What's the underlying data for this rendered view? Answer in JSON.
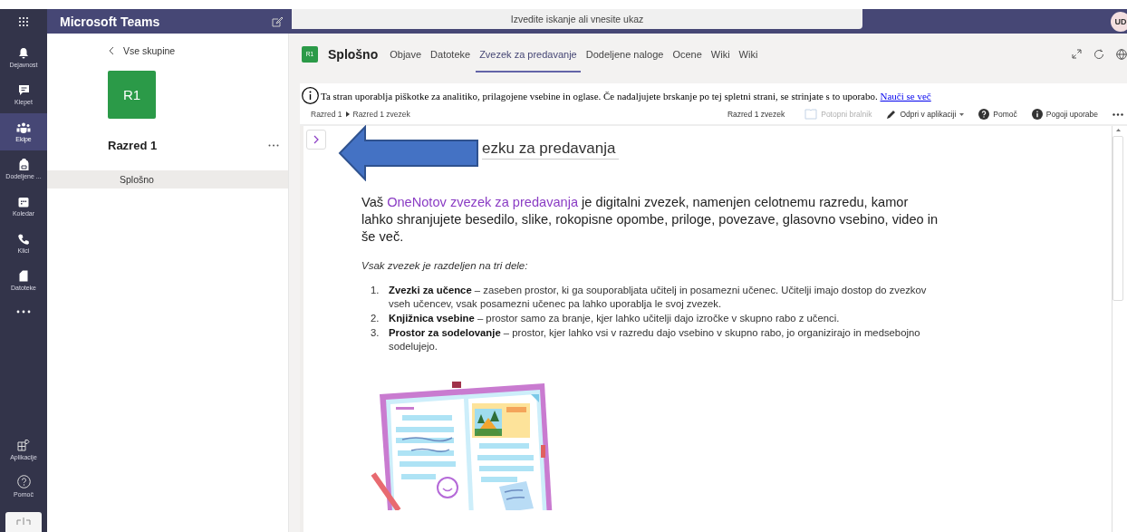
{
  "app_bar": {
    "title": "Microsoft Teams",
    "search": {
      "placeholder": "Izvedite iskanje ali vnesite ukaz"
    },
    "avatar": "UD"
  },
  "rail": [
    {
      "label": "Dejavnost",
      "kind": "bell",
      "selected": false
    },
    {
      "label": "Klepet",
      "kind": "chat",
      "selected": false
    },
    {
      "label": "Ekipe",
      "kind": "teams",
      "selected": true
    },
    {
      "label": "Dodeljene ...",
      "kind": "backpack",
      "selected": false
    },
    {
      "label": "Koledar",
      "kind": "calendar",
      "selected": false
    },
    {
      "label": "Klici",
      "kind": "phone",
      "selected": false
    },
    {
      "label": "Datoteke",
      "kind": "file",
      "selected": false
    }
  ],
  "rail_bottom": [
    {
      "label": "Aplikacije",
      "kind": "apps",
      "selected": false
    },
    {
      "label": "Pomoč",
      "kind": "help",
      "selected": false
    }
  ],
  "team_panel": {
    "back": "Vse skupine",
    "tile": "R1",
    "name": "Razred 1",
    "channels": [
      {
        "name": "Splošno",
        "selected": true
      }
    ]
  },
  "channel_header": {
    "tile": "R1",
    "name": "Splošno",
    "tabs": [
      {
        "label": "Objave",
        "selected": false
      },
      {
        "label": "Datoteke",
        "selected": false
      },
      {
        "label": "Zvezek za predavanje",
        "selected": true
      },
      {
        "label": "Dodeljene naloge",
        "selected": false
      },
      {
        "label": "Ocene",
        "selected": false
      },
      {
        "label": "Wiki",
        "selected": false
      },
      {
        "label": "Wiki",
        "selected": false
      }
    ]
  },
  "cookie_banner": {
    "text": "Ta stran uporablja piškotke za analitiko, prilagojene vsebine in oglase. Če nadaljujete brskanje po tej spletni strani, se strinjate s to uporabo.",
    "link": "Nauči se več"
  },
  "toolbar": {
    "breadcrumb": [
      "Razred 1",
      "Razred 1 zvezek"
    ],
    "notebook": "Razred 1 zvezek",
    "actions": [
      {
        "label": "Potopni bralnik",
        "kind": "reader",
        "disabled": true
      },
      {
        "label": "Odpri v aplikaciji",
        "kind": "edit",
        "disabled": false
      },
      {
        "label": "Pomoč",
        "kind": "help",
        "disabled": false
      },
      {
        "label": "Pogoji uporabe",
        "kind": "info",
        "disabled": false
      }
    ]
  },
  "page": {
    "title": "ezku za predavanja",
    "intro_before": "Vaš",
    "intro_link": "OneNotov zvezek za predavanja",
    "intro_after": "je digitalni zvezek, namenjen celotnemu razredu, kamor lahko shranjujete besedilo, slike, rokopisne opombe, priloge, povezave, glasovno vsebino, video in še več.",
    "lead": "Vsak zvezek je razdeljen na tri dele:",
    "items": [
      {
        "number": "1.",
        "text": "**Zvezki za učence** – zaseben prostor, ki ga souporabljata učitelj in posamezni učenec. Učitelji imajo dostop do zvezkov vseh učencev, vsak posamezni učenec pa lahko uporablja le svoj zvezek."
      },
      {
        "number": "2.",
        "text": "**Knjižnica vsebine** – prostor samo za branje, kjer lahko učitelji dajo izročke v skupno rabo z učenci."
      },
      {
        "number": "3.",
        "text": "**Prostor za sodelovanje** – prostor, kjer lahko vsi v razredu dajo vsebino v skupno rabo, jo organizirajo in medsebojno sodelujejo."
      }
    ]
  }
}
